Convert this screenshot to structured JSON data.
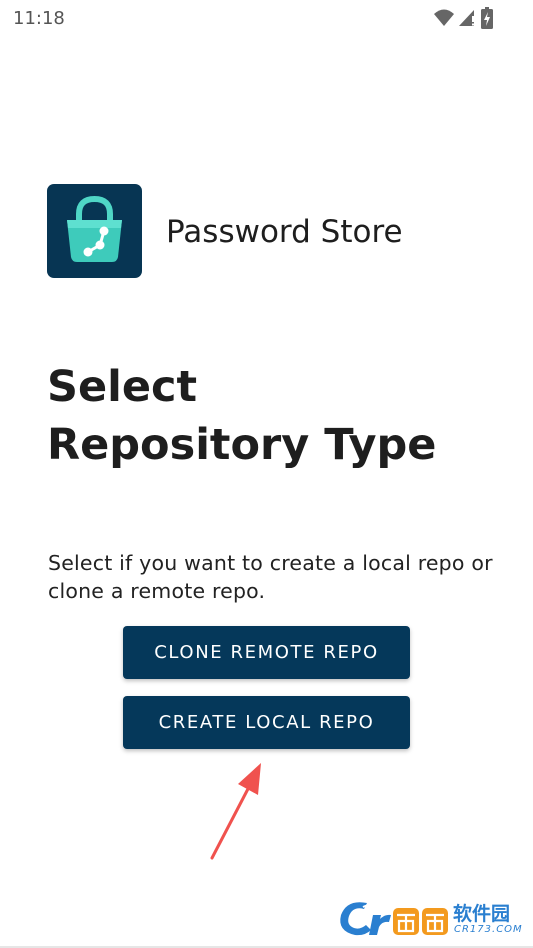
{
  "status_bar": {
    "time": "11:18",
    "icons": [
      "wifi-icon",
      "signal-icon",
      "battery-icon"
    ]
  },
  "app": {
    "name": "Password Store",
    "logo_icon": "lock-bag-icon",
    "brand_color": "#073553",
    "accent_color": "#3fd3c0"
  },
  "page": {
    "title_line1": "Select",
    "title_line2": "Repository Type",
    "description": "Select if you want to create a local repo or clone a remote repo."
  },
  "buttons": {
    "clone_label": "CLONE REMOTE REPO",
    "create_label": "CREATE LOCAL REPO",
    "color": "#05385a"
  },
  "annotation": {
    "arrow_color": "#f0524e"
  },
  "watermark": {
    "logo": "cr173-logo",
    "text": "软件园",
    "url": "CR173.COM"
  }
}
